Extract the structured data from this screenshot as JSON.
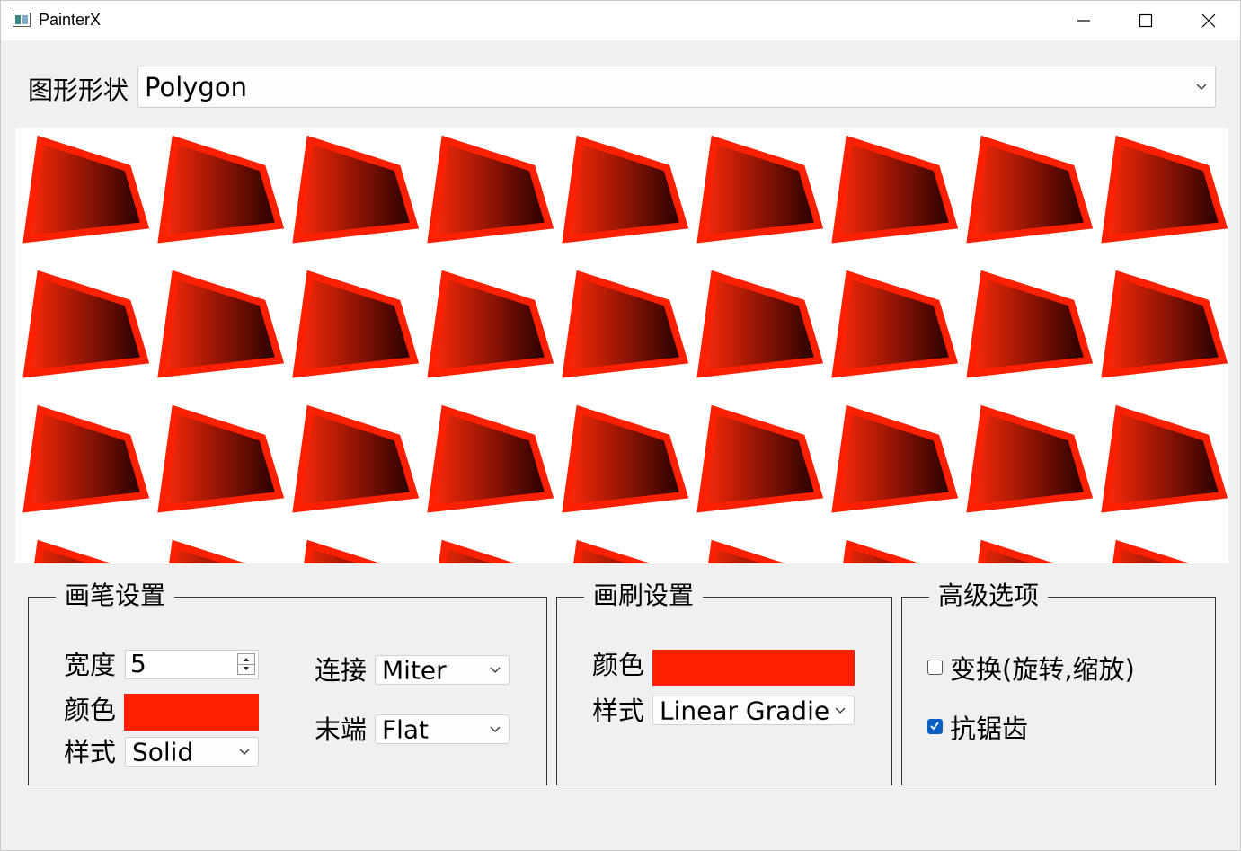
{
  "window": {
    "title": "PainterX"
  },
  "shape": {
    "label": "图形形状",
    "value": "Polygon"
  },
  "canvas": {
    "fill_gradient": [
      "#ff2a0a",
      "#220000"
    ],
    "outline_color": "#ff2000",
    "polygon_visible_rows": 4,
    "polygon_columns": 9
  },
  "pen": {
    "title": "画笔设置",
    "width_label": "宽度",
    "width_value": "5",
    "color_label": "颜色",
    "color": "#ff2000",
    "style_label": "样式",
    "style_value": "Solid",
    "join_label": "连接",
    "join_value": "Miter",
    "cap_label": "末端",
    "cap_value": "Flat"
  },
  "brush": {
    "title": "画刷设置",
    "color_label": "颜色",
    "color": "#ff2000",
    "style_label": "样式",
    "style_value": "Linear Gradier"
  },
  "advanced": {
    "title": "高级选项",
    "transform_label": "变换(旋转,缩放)",
    "transform_checked": false,
    "antialias_label": "抗锯齿",
    "antialias_checked": true
  },
  "icons": [
    "app-icon",
    "minimize-icon",
    "maximize-icon",
    "close-icon",
    "chevron-down-icon",
    "spin-up-icon",
    "spin-down-icon",
    "checkmark-icon"
  ]
}
